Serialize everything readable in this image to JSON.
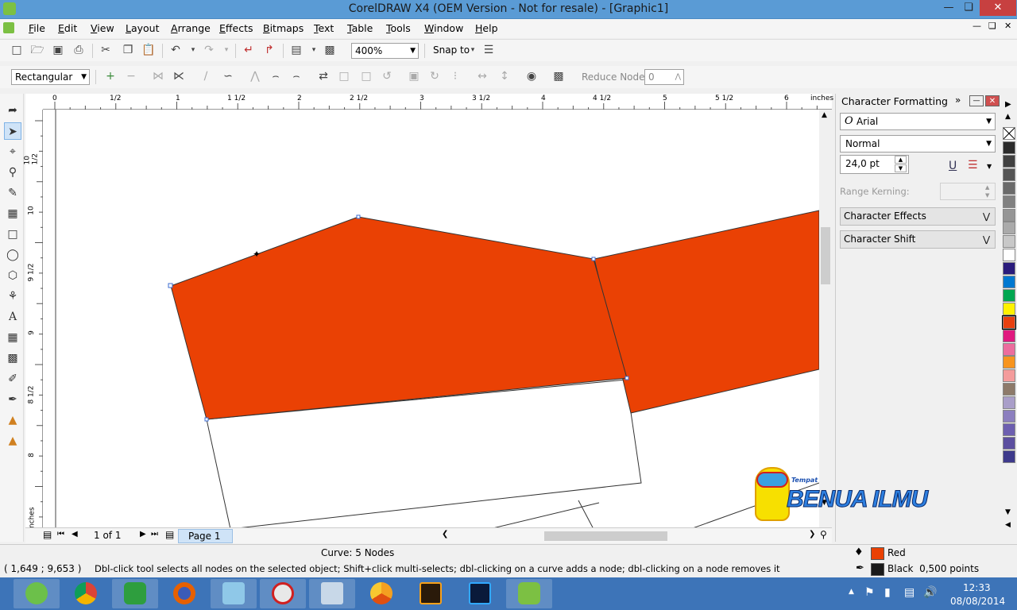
{
  "window": {
    "title": "CorelDRAW X4 (OEM Version - Not for resale) - [Graphic1]"
  },
  "menu": [
    "File",
    "Edit",
    "View",
    "Layout",
    "Arrange",
    "Effects",
    "Bitmaps",
    "Text",
    "Table",
    "Tools",
    "Window",
    "Help"
  ],
  "standard_bar": {
    "zoom": "400%",
    "snap_to": "Snap to"
  },
  "property_bar": {
    "shape_mode": "Rectangular",
    "reduce_nodes_label": "Reduce Nodes",
    "reduce_nodes_value": "0"
  },
  "rulers": {
    "unit": "inches",
    "h_labels": [
      "0",
      "1/2",
      "1",
      "1 1/2",
      "2",
      "2 1/2",
      "3",
      "3 1/2",
      "4",
      "4 1/2",
      "5",
      "5 1/2",
      "6"
    ],
    "v_labels": [
      "10 1/2",
      "10",
      "9 1/2",
      "9",
      "8 1/2",
      "8"
    ]
  },
  "page_nav": {
    "count": "1 of 1",
    "tab": "Page 1"
  },
  "docker": {
    "title": "Character Formatting",
    "font": "Arial",
    "style": "Normal",
    "size": "24,0 pt",
    "range_kerning": "Range Kerning:",
    "effects": "Character Effects",
    "shift": "Character Shift"
  },
  "palette_colors": [
    "#2b2b2b",
    "#404040",
    "#555555",
    "#6a6a6a",
    "#808080",
    "#959595",
    "#aaaaaa",
    "#c8c8c8",
    "#ffffff",
    "#2a1b7c",
    "#0078d0",
    "#00a650",
    "#fff200",
    "#e84010",
    "#e0197f",
    "#ec6d9e",
    "#f7941e",
    "#f49c9c",
    "#8d7a6a",
    "#a99ec9",
    "#8c7fbf",
    "#6d5fb0",
    "#5c4fa0",
    "#3e3a8c"
  ],
  "shape_colors": {
    "fill": "#ea4104",
    "outline": "#333333"
  },
  "watermark": {
    "tagline": "Tempat Cari-Cari Ilmu Yang Bermutu",
    "brand": "BENUA ILMU"
  },
  "status": {
    "object": "Curve: 5 Nodes",
    "coords": "( 1,649 ; 9,653 )",
    "hint": "Dbl-click tool selects all nodes on the selected object; Shift+click multi-selects; dbl-clicking on a curve adds a node; dbl-clicking on a node removes it",
    "fill_name": "Red",
    "outline_name": "Black  0,500 points",
    "fill_color": "#ea4104",
    "outline_color": "#1a1a1a"
  },
  "taskbar": {
    "time": "12:33",
    "date": "08/08/2014",
    "apps": [
      "clover",
      "chrome",
      "app-green",
      "firefox",
      "coreldraw-pad",
      "snipping",
      "monitor",
      "chrome-canary",
      "illustrator",
      "photoshop",
      "coreldraw"
    ]
  }
}
